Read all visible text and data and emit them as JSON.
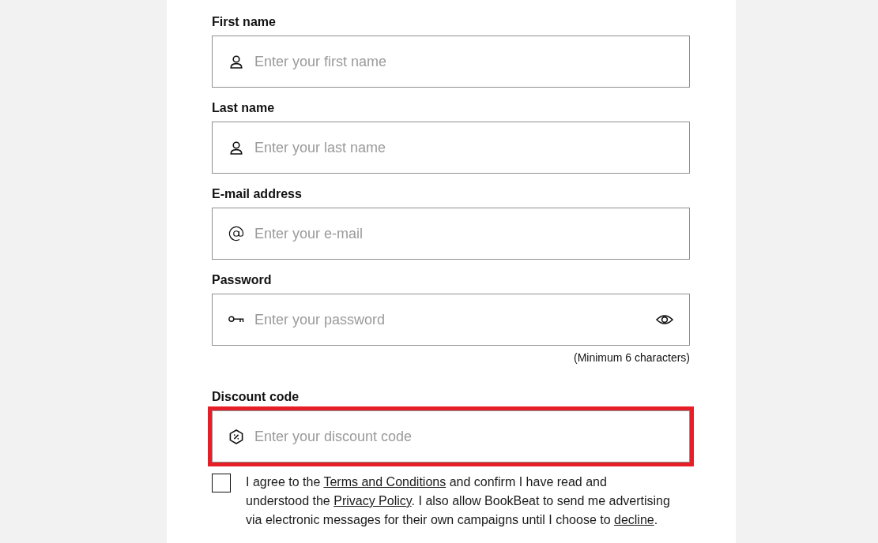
{
  "form": {
    "fields": [
      {
        "kind": "name",
        "label": "First name",
        "placeholder": "Enter your first name",
        "highlighted": false
      },
      {
        "kind": "name",
        "label": "Last name",
        "placeholder": "Enter your last name",
        "highlighted": false
      },
      {
        "kind": "email",
        "label": "E-mail address",
        "placeholder": "Enter your e-mail",
        "highlighted": false
      },
      {
        "kind": "password",
        "label": "Password",
        "placeholder": "Enter your password",
        "hint": "(Minimum 6 characters)",
        "highlighted": false
      },
      {
        "kind": "discount",
        "label": "Discount code",
        "placeholder": "Enter your discount code",
        "highlighted": true
      }
    ],
    "consent": {
      "checked": false,
      "segments": [
        {
          "kind": "text",
          "text": "I agree to the "
        },
        {
          "kind": "link",
          "text": "Terms and Conditions"
        },
        {
          "kind": "text",
          "text": " and confirm I have read and understood the "
        },
        {
          "kind": "link",
          "text": "Privacy Policy"
        },
        {
          "kind": "text",
          "text": ". I also allow BookBeat to send me advertising via electronic messages for their own campaigns until I choose to "
        },
        {
          "kind": "link",
          "text": "decline"
        },
        {
          "kind": "text",
          "text": "."
        }
      ]
    }
  }
}
